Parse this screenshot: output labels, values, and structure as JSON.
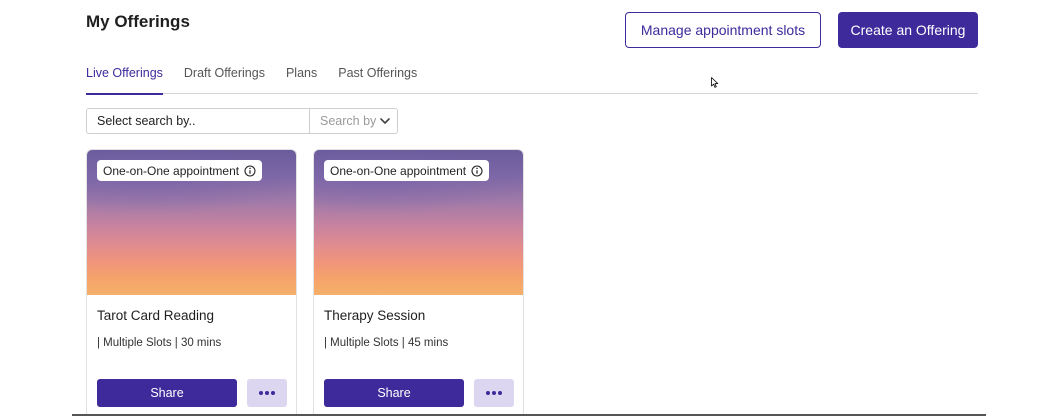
{
  "header": {
    "title": "My Offerings",
    "manage_label": "Manage appointment slots",
    "create_label": "Create an Offering"
  },
  "tabs": [
    {
      "label": "Live Offerings",
      "active": true
    },
    {
      "label": "Draft Offerings",
      "active": false
    },
    {
      "label": "Plans",
      "active": false
    },
    {
      "label": "Past Offerings",
      "active": false
    }
  ],
  "search": {
    "placeholder": "Select search by..",
    "search_by_label": "Search by"
  },
  "offerings": [
    {
      "badge": "One-on-One appointment",
      "title": "Tarot Card Reading",
      "meta": "| Multiple Slots | 30 mins",
      "share_label": "Share"
    },
    {
      "badge": "One-on-One appointment",
      "title": "Therapy Session",
      "meta": "| Multiple Slots | 45 mins",
      "share_label": "Share"
    }
  ],
  "colors": {
    "accent": "#3f2a9c",
    "accent_light": "#dcd6f0"
  },
  "icons": {
    "info": "info-icon",
    "more": "ellipsis-icon",
    "dropdown": "chevron-down-icon"
  }
}
